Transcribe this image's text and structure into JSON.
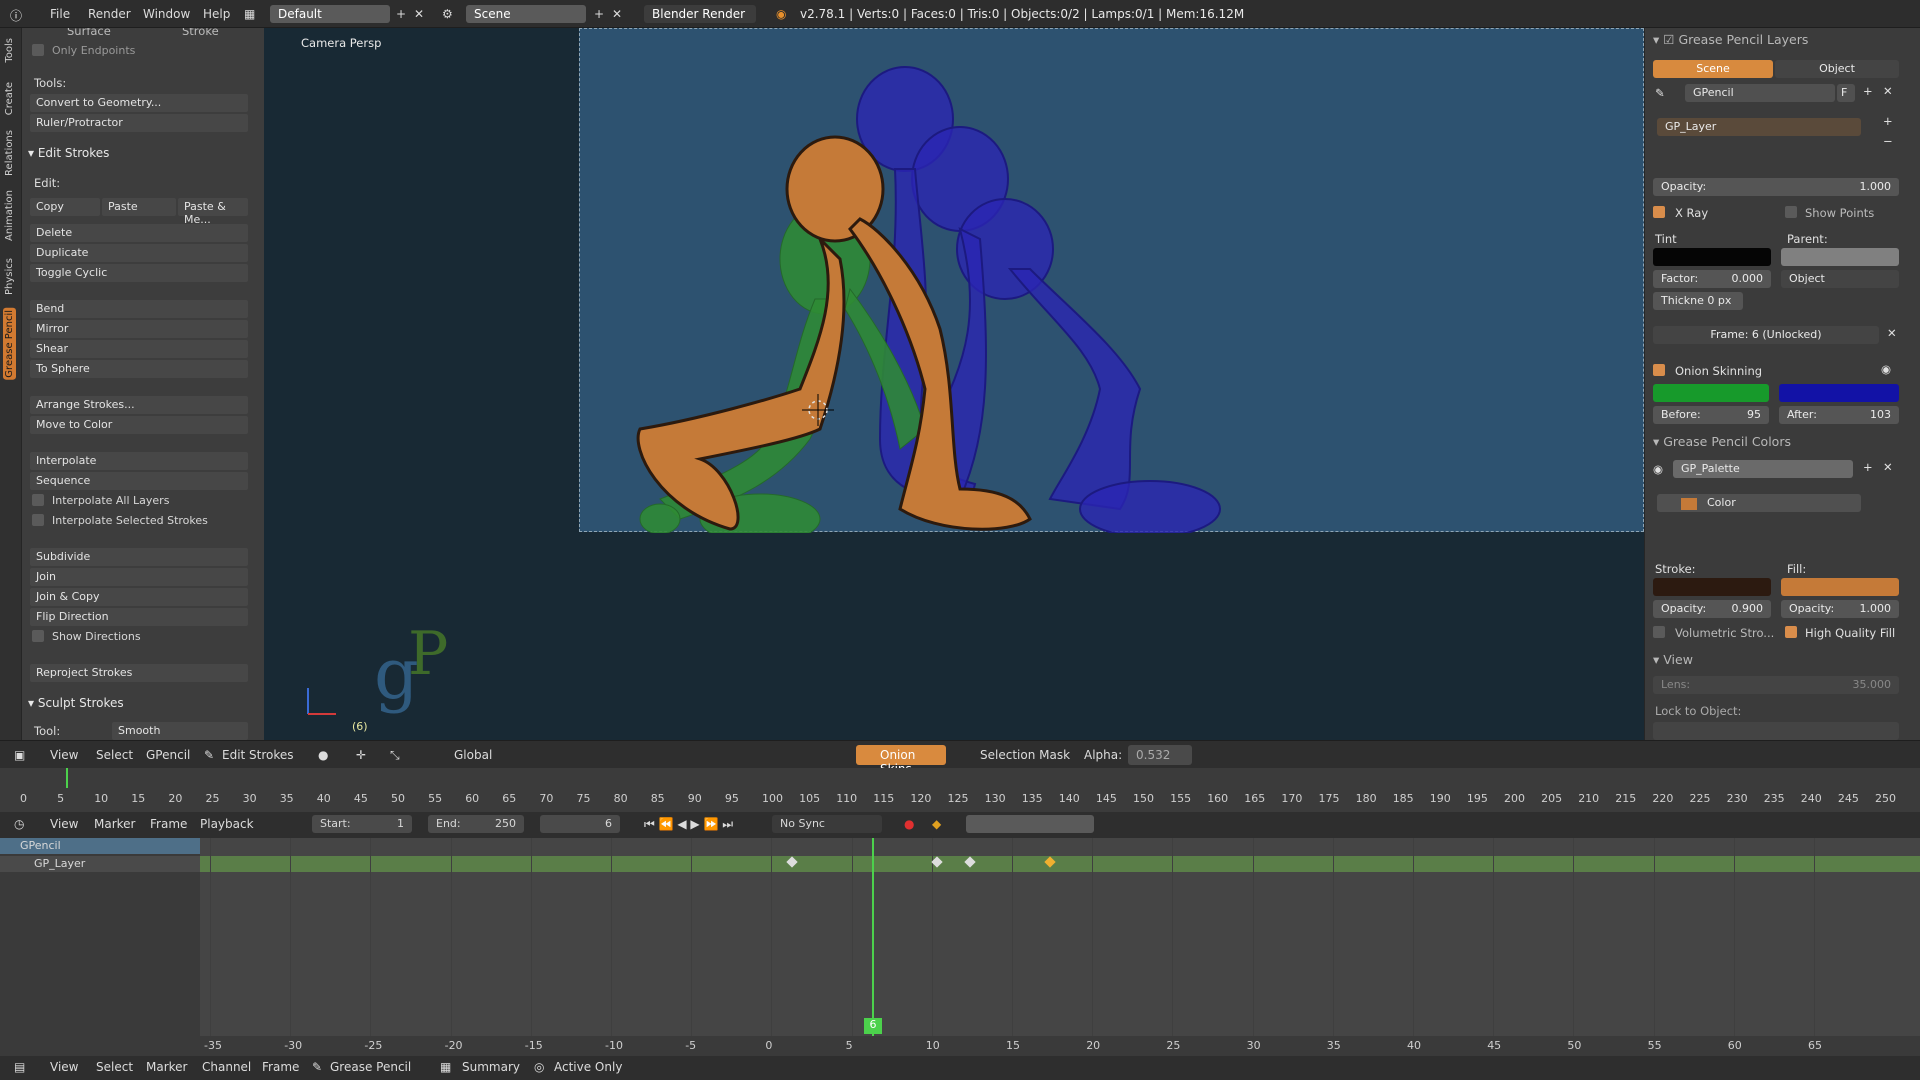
{
  "topbar": {
    "menus": [
      "File",
      "Render",
      "Window",
      "Help"
    ],
    "layout": "Default",
    "scene": "Scene",
    "engine": "Blender Render",
    "stats": "v2.78.1 | Verts:0 | Faces:0 | Tris:0 | Objects:0/2 | Lamps:0/1 | Mem:16.12M"
  },
  "vtabs": [
    "Tools",
    "Create",
    "Relations",
    "Animation",
    "Physics",
    "Grease Pencil"
  ],
  "shelf": {
    "top_labels": [
      "Surface",
      "Stroke"
    ],
    "only_endpoints": "Only Endpoints",
    "tools_label": "Tools:",
    "convert": "Convert to Geometry...",
    "ruler": "Ruler/Protractor",
    "edit_strokes": "Edit Strokes",
    "edit_label": "Edit:",
    "copy": "Copy",
    "paste": "Paste",
    "paste_merge": "Paste & Me...",
    "delete": "Delete",
    "duplicate": "Duplicate",
    "toggle_cyclic": "Toggle Cyclic",
    "bend": "Bend",
    "mirror": "Mirror",
    "shear": "Shear",
    "to_sphere": "To Sphere",
    "arrange": "Arrange Strokes...",
    "move_to_color": "Move to Color",
    "interpolate": "Interpolate",
    "sequence": "Sequence",
    "interp_all": "Interpolate All Layers",
    "interp_sel": "Interpolate Selected Strokes",
    "subdivide": "Subdivide",
    "join": "Join",
    "join_copy": "Join & Copy",
    "flip": "Flip Direction",
    "show_dirs": "Show Directions",
    "reproject": "Reproject Strokes",
    "sculpt": "Sculpt Strokes",
    "tool_label": "Tool:",
    "tool_value": "Smooth"
  },
  "viewport": {
    "title": "Camera Persp",
    "frame_indicator": "(6)"
  },
  "rpanel": {
    "layers_title": "Grease Pencil Layers",
    "tab_scene": "Scene",
    "tab_object": "Object",
    "gpencil": "GPencil",
    "f": "F",
    "layer": "GP_Layer",
    "opacity_label": "Opacity:",
    "opacity_value": "1.000",
    "xray": "X Ray",
    "show_points": "Show Points",
    "tint": "Tint",
    "parent": "Parent:",
    "factor": "Factor:",
    "factor_value": "0.000",
    "object": "Object",
    "thickness": "Thickne",
    "thickness_value": "0 px",
    "frame": "Frame: 6 (Unlocked)",
    "onion": "Onion Skinning",
    "before_label": "Before:",
    "before_value": "95",
    "after_label": "After:",
    "after_value": "103",
    "colors_title": "Grease Pencil Colors",
    "palette": "GP_Palette",
    "color": "Color",
    "stroke": "Stroke:",
    "fill": "Fill:",
    "stroke_opacity": "Opacity:",
    "stroke_opacity_value": "0.900",
    "fill_opacity": "Opacity:",
    "fill_opacity_value": "1.000",
    "volumetric": "Volumetric Stro...",
    "hq_fill": "High Quality Fill",
    "view_title": "View",
    "lens": "Lens:",
    "lens_value": "35.000",
    "lock": "Lock to Object:"
  },
  "vhdr": {
    "view": "View",
    "select": "Select",
    "gpencil": "GPencil",
    "mode": "Edit Strokes",
    "orient": "Global",
    "onion": "Onion Skins",
    "selmask": "Selection Mask",
    "alpha_label": "Alpha:",
    "alpha_value": "0.532"
  },
  "timeline": {
    "ticks": [
      "0",
      "5",
      "10",
      "15",
      "20",
      "25",
      "30",
      "35",
      "40",
      "45",
      "50",
      "55",
      "60",
      "65",
      "70",
      "75",
      "80",
      "85",
      "90",
      "95",
      "100",
      "105",
      "110",
      "115",
      "120",
      "125",
      "130",
      "135",
      "140",
      "145",
      "150",
      "155",
      "160",
      "165",
      "170",
      "175",
      "180",
      "185",
      "190",
      "195",
      "200",
      "205",
      "210",
      "215",
      "220",
      "225",
      "230",
      "235",
      "240",
      "245",
      "250"
    ],
    "view": "View",
    "marker": "Marker",
    "frame": "Frame",
    "playback": "Playback",
    "start_label": "Start:",
    "start_value": "1",
    "end_label": "End:",
    "end_value": "250",
    "current": "6",
    "sync": "No Sync"
  },
  "dopesheet": {
    "gpencil": "GPencil",
    "layer": "GP_Layer",
    "current_frame": "6",
    "ticks": [
      "-35",
      "-30",
      "-25",
      "-20",
      "-15",
      "-10",
      "-5",
      "0",
      "5",
      "10",
      "15",
      "20",
      "25",
      "30",
      "35",
      "40",
      "45",
      "50",
      "55",
      "60",
      "65"
    ]
  },
  "bottom": {
    "view": "View",
    "select": "Select",
    "marker": "Marker",
    "channel": "Channel",
    "frame": "Frame",
    "mode": "Grease Pencil",
    "summary": "Summary",
    "active_only": "Active Only"
  }
}
